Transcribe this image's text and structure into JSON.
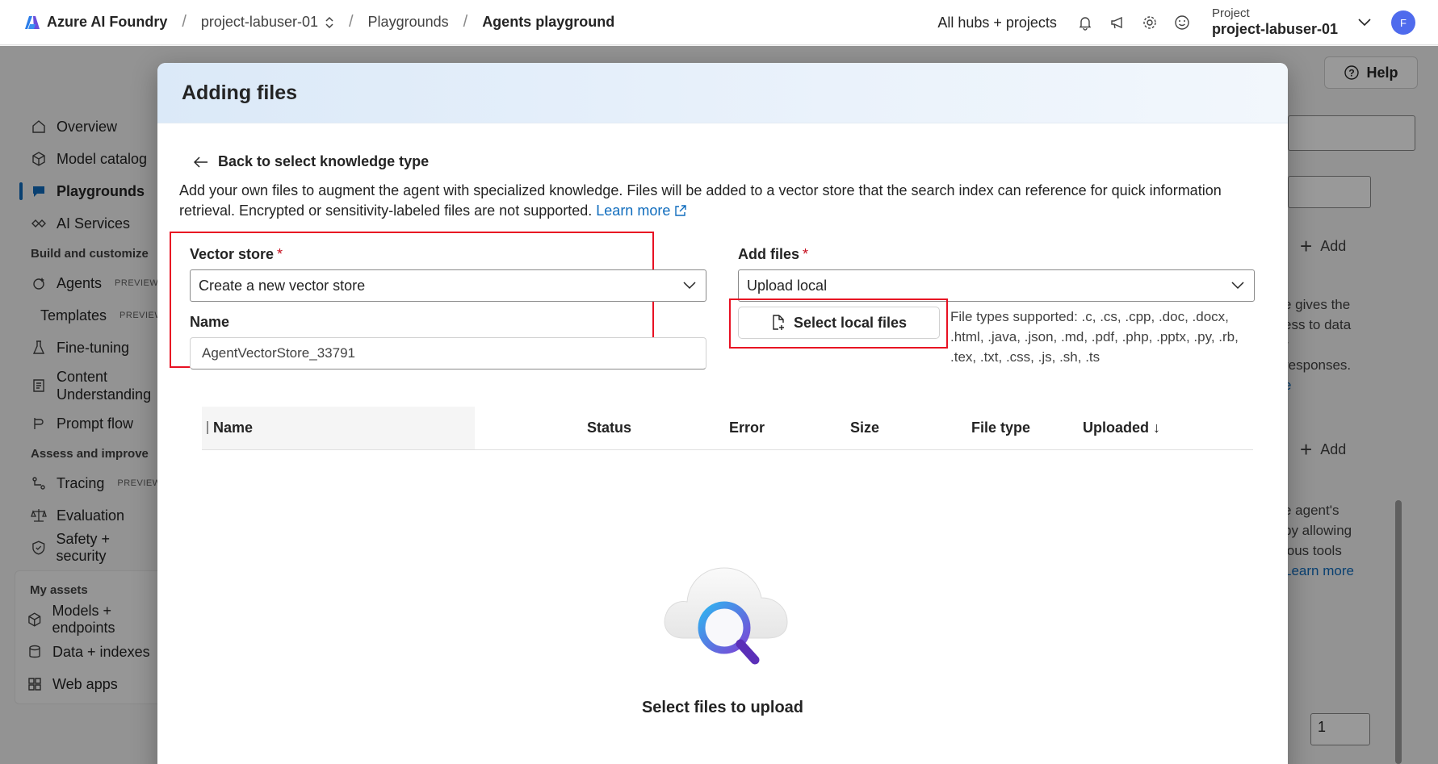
{
  "topbar": {
    "brand": "Azure AI Foundry",
    "project_crumb": "project-labuser-01",
    "crumb_playgrounds": "Playgrounds",
    "crumb_current": "Agents playground",
    "all_hubs": "All hubs + projects",
    "project_label": "Project",
    "project_name": "project-labuser-01",
    "avatar_initial": "F"
  },
  "sidebar": {
    "items_top": [
      {
        "label": "Overview",
        "icon": "home-icon"
      },
      {
        "label": "Model catalog",
        "icon": "cube-icon"
      },
      {
        "label": "Playgrounds",
        "icon": "chat-icon"
      },
      {
        "label": "AI Services",
        "icon": "link-icon"
      }
    ],
    "section_build": "Build and customize",
    "items_build": [
      {
        "label": "Agents",
        "tag": "PREVIEW"
      },
      {
        "label": "Templates",
        "tag": "PREVIEW"
      },
      {
        "label": "Fine-tuning"
      },
      {
        "label": "Content Understanding"
      },
      {
        "label": "Prompt flow"
      }
    ],
    "section_assess": "Assess and improve",
    "items_assess": [
      {
        "label": "Tracing",
        "tag": "PREVIEW"
      },
      {
        "label": "Evaluation"
      },
      {
        "label": "Safety + security"
      }
    ],
    "section_assets": "My assets",
    "items_assets": [
      {
        "label": "Models + endpoints"
      },
      {
        "label": "Data + indexes"
      },
      {
        "label": "Web apps"
      }
    ]
  },
  "right_panel": {
    "help": "Help",
    "add1": "Add",
    "add2": "Add",
    "text1": "e gives the",
    "text1b": "ess to data",
    "text1c": "r",
    "text1d": "responses.",
    "text1e": "e",
    "text2": "e agent's",
    "text2b": "by allowing",
    "text2c": "ious tools",
    "text2d": "Learn more",
    "number_value": "1"
  },
  "modal": {
    "title": "Adding files",
    "back_link": "Back to select knowledge type",
    "description": "Add your own files to augment the agent with specialized knowledge. Files will be added to a vector store that the search index can reference for quick information retrieval. Encrypted or sensitivity-labeled files are not supported.",
    "learn_more": "Learn more",
    "vector_store_label": "Vector store",
    "vector_store_value": "Create a new vector store",
    "name_label": "Name",
    "name_value": "AgentVectorStore_33791",
    "add_files_label": "Add files",
    "add_files_value": "Upload local",
    "select_local_files": "Select local files",
    "file_types": "File types supported: .c, .cs, .cpp, .doc, .docx, .html, .java, .json, .md, .pdf, .php, .pptx, .py, .rb, .tex, .txt, .css, .js, .sh, .ts",
    "required_marker": "*",
    "table_columns": [
      "Name",
      "Status",
      "Error",
      "Size",
      "File type",
      "Uploaded ↓"
    ],
    "empty_state": "Select files to upload"
  },
  "colors": {
    "accent": "#0f6cbd",
    "highlight_box": "#e81123",
    "required": "#c50f1f"
  }
}
